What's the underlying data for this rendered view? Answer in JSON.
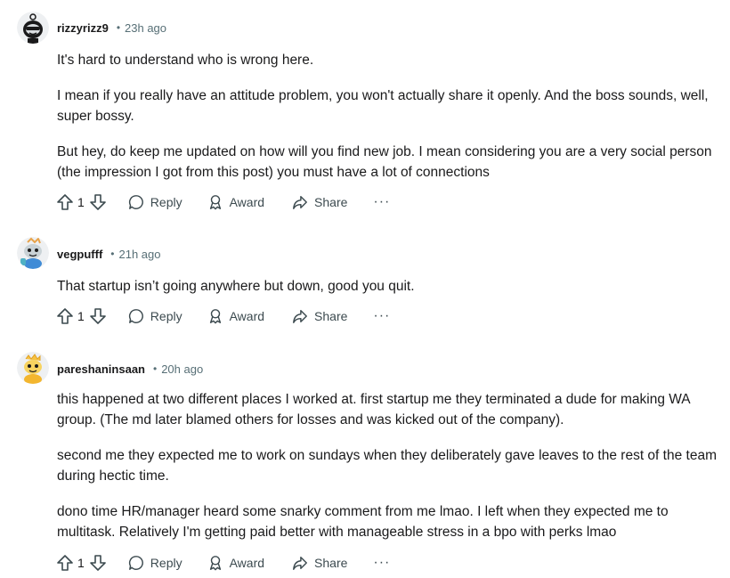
{
  "actions": {
    "reply": "Reply",
    "award": "Award",
    "share": "Share",
    "more": "···"
  },
  "comments": [
    {
      "username": "rizzyrizz9",
      "separator": "•",
      "time": "23h ago",
      "votes": "1",
      "paragraphs": [
        "It's hard to understand who is wrong here.",
        "I mean if you really have an attitude problem, you won't actually share it openly. And the boss sounds, well, super bossy.",
        "But hey, do keep me updated on how will you find new job. I mean considering you are a very social person (the impression I got from this post) you must have a lot of connections"
      ]
    },
    {
      "username": "vegpufff",
      "separator": "•",
      "time": "21h ago",
      "votes": "1",
      "paragraphs": [
        "That startup isn’t going anywhere but down, good you quit."
      ]
    },
    {
      "username": "pareshaninsaan",
      "separator": "•",
      "time": "20h ago",
      "votes": "1",
      "paragraphs": [
        "this happened at two different places I worked at. first startup me they terminated a dude for making WA group. (The md later blamed others for losses and was kicked out of the company).",
        "second me they expected me to work on sundays when they deliberately gave leaves to the rest of the team during hectic time.",
        "dono time HR/manager heard some snarky comment from me lmao. I left when they expected me to multitask. Relatively I'm getting paid better with manageable stress in a bpo with perks lmao"
      ]
    }
  ]
}
